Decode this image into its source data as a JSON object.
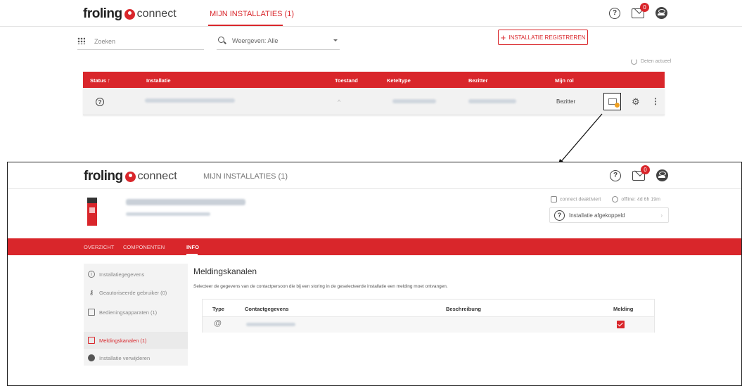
{
  "brand": {
    "logo_part1": "froling",
    "logo_part2": "connect",
    "accent": "#d9262b"
  },
  "top": {
    "nav": {
      "installations_label": "MIJN INSTALLATIES (1)"
    },
    "header_icons": {
      "mail_badge": "0"
    },
    "search": {
      "placeholder": "Zoeken",
      "filter_label": "Weergeven: Alle"
    },
    "register_button": {
      "plus": "+",
      "label": "INSTALLATIE REGISTREREN"
    },
    "refresh_label": "Deten actueel",
    "table": {
      "headers": [
        "Status ↑",
        "Installatie",
        "Toestand",
        "Keteltype",
        "Bezitter",
        "Mijn rol"
      ],
      "row": {
        "status_icon": "?",
        "state": "^",
        "role": "Bezitter"
      }
    }
  },
  "bottom": {
    "nav": {
      "installations_label": "MIJN INSTALLATIES (1)"
    },
    "header_icons": {
      "mail_badge": "0"
    },
    "hero": {
      "connection_status": "connect deaktiviert",
      "offline_status": "offline: 4d 6h 19m",
      "disconnect_label": "Installatie afgekoppeld",
      "disconnect_icon": "?",
      "chevron": "›"
    },
    "tabs": [
      "OVERZICHT",
      "COMPONENTEN",
      "INFO"
    ],
    "sidebar": [
      {
        "icon": "i",
        "label": "Installatiegegevens"
      },
      {
        "icon": "key",
        "label": "Geautoriseerde gebruiker (0)"
      },
      {
        "icon": "device",
        "label": "Bedieningsapparaten (1)"
      },
      {
        "icon": "mail",
        "label": "Meldingskanalen (1)"
      },
      {
        "icon": "delete",
        "label": "Installatie verwijderen"
      }
    ],
    "main": {
      "title": "Meldingskanalen",
      "description": "Selecteer de gegevens van de contactpersoon die bij een storing in de geselecteerde installatie een melding moet ontvangen.",
      "table": {
        "headers": [
          "Type",
          "Contactgegevens",
          "Beschreibung",
          "Melding"
        ],
        "row": {
          "type_icon": "@",
          "melding_checked": true
        }
      }
    }
  }
}
